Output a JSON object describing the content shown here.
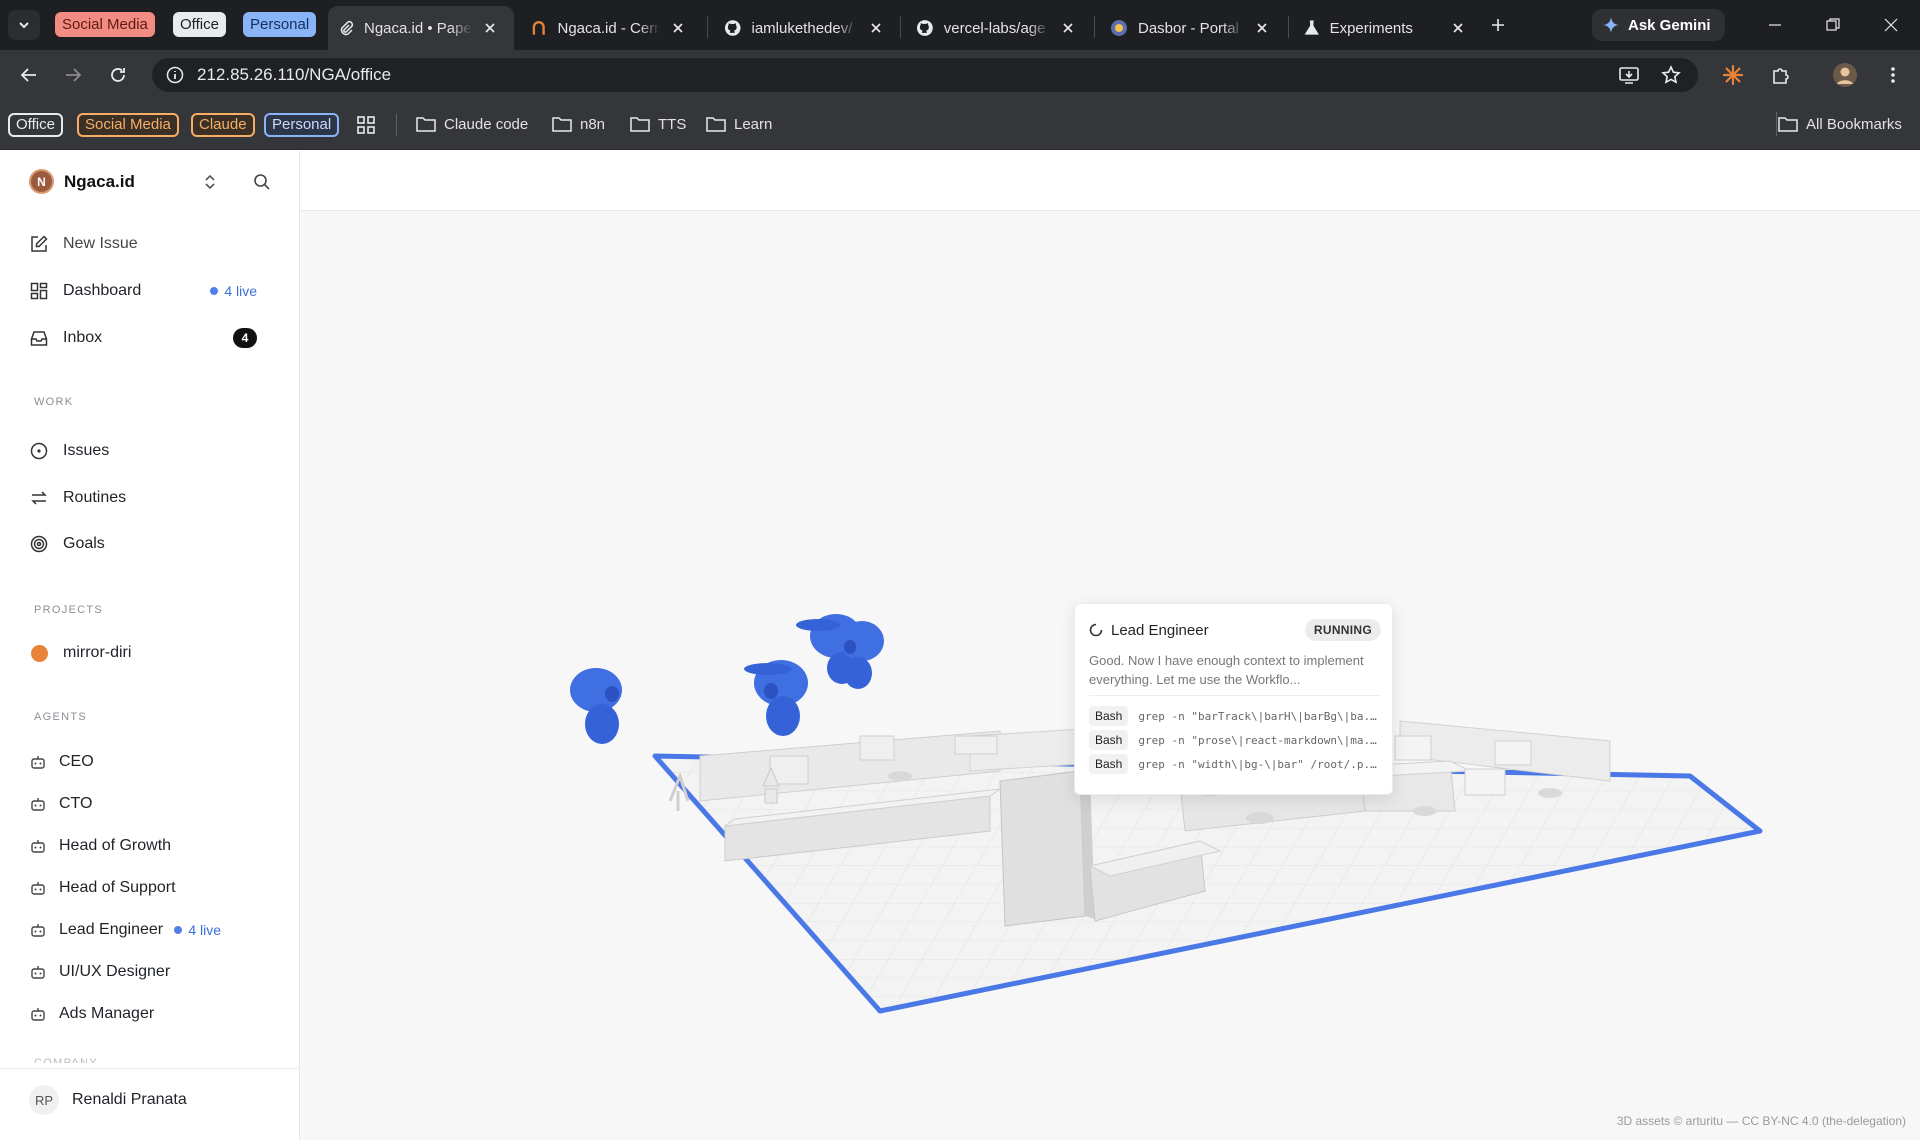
{
  "browser": {
    "tab_groups": [
      {
        "label": "Social Media",
        "bg": "#f28b82",
        "fg": "#5f1b14"
      },
      {
        "label": "Office",
        "bg": "#e8eaed",
        "fg": "#202124"
      },
      {
        "label": "Personal",
        "bg": "#8ab4f8",
        "fg": "#13305c"
      }
    ],
    "tabs": [
      {
        "title": "Ngaca.id • Paperclip",
        "icon": "paperclip-icon",
        "active": true
      },
      {
        "title": "Ngaca.id - Cerm",
        "icon": "arch-logo-icon",
        "active": false
      },
      {
        "title": "iamlukethedev/",
        "icon": "github-icon",
        "active": false
      },
      {
        "title": "vercel-labs/age",
        "icon": "github-icon",
        "active": false
      },
      {
        "title": "Dasbor - Portal",
        "icon": "portal-logo-icon",
        "active": false
      },
      {
        "title": "Experiments",
        "icon": "flask-icon",
        "active": false
      }
    ],
    "gemini_label": "Ask Gemini",
    "url": "212.85.26.110/NGA/office",
    "bookmark_groups": [
      {
        "label": "Office",
        "border": "#e8eaed",
        "fg": "#e8eaed",
        "bg": "transparent"
      },
      {
        "label": "Social Media",
        "border": "#f6ae66",
        "fg": "#f6ae66",
        "bg": "#3a3026"
      },
      {
        "label": "Claude",
        "border": "#f6ae66",
        "fg": "#f6ae66",
        "bg": "#3a3026"
      },
      {
        "label": "Personal",
        "border": "#8ab4f8",
        "fg": "#c6dafc",
        "bg": "#2d3648"
      }
    ],
    "bookmark_folders": [
      "Claude code",
      "n8n",
      "TTS",
      "Learn"
    ],
    "all_bookmarks": "All Bookmarks"
  },
  "sidebar": {
    "brand": "Ngaca.id",
    "brand_initial": "N",
    "nav": {
      "new_issue": "New Issue",
      "dashboard": "Dashboard",
      "dashboard_live": "4 live",
      "inbox": "Inbox",
      "inbox_count": "4"
    },
    "work_label": "WORK",
    "work": [
      "Issues",
      "Routines",
      "Goals"
    ],
    "projects_label": "PROJECTS",
    "project": "mirror-diri",
    "agents_label": "AGENTS",
    "agents": [
      "CEO",
      "CTO",
      "Head of Growth",
      "Head of Support",
      "Lead Engineer",
      "UI/UX Designer",
      "Ads Manager"
    ],
    "lead_live": "4 live",
    "cut_label": "COMPANY",
    "user_initials": "RP",
    "user_name": "Renaldi Pranata"
  },
  "popup": {
    "title": "Lead Engineer",
    "status": "RUNNING",
    "message": "Good. Now I have enough context to implement everything. Let me use the Workflo...",
    "commands": [
      {
        "tool": "Bash",
        "cmd": "grep -n \"barTrack\\|barH\\|barBg\\|ba..."
      },
      {
        "tool": "Bash",
        "cmd": "grep -n \"prose\\|react-markdown\\|ma..."
      },
      {
        "tool": "Bash",
        "cmd": "grep -n \"width\\|bg-\\|bar\" /root/.p..."
      }
    ]
  },
  "credits": "3D assets © arturitu — CC BY-NC 4.0 (the-delegation)",
  "colors": {
    "accent": "#4f7fe8",
    "robot": "#3f6fe0",
    "floor_outline": "#4a78e6"
  }
}
